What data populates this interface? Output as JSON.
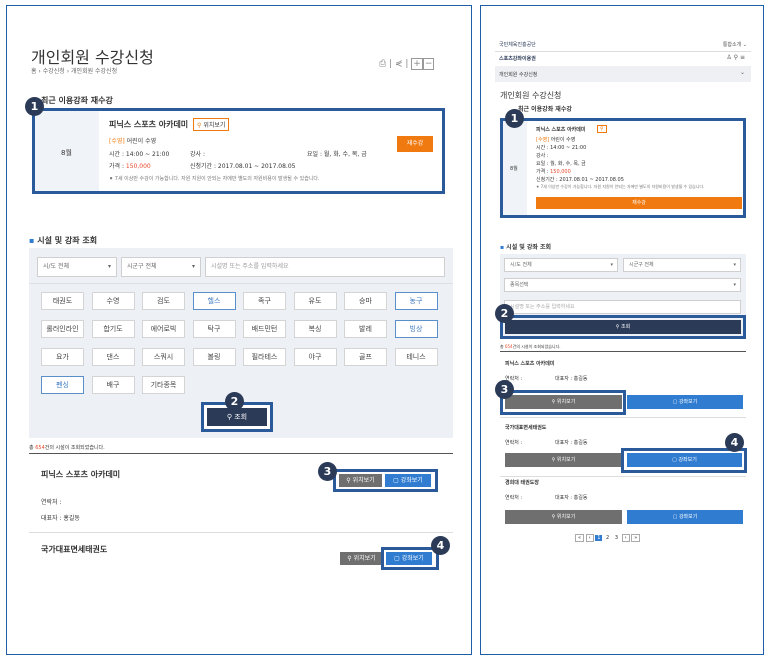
{
  "desktop": {
    "title": "개인회원 수강신청",
    "breadcrumb": "홈 › 수강신청 › 개인회원 수강신청",
    "recent_heading": "최근 이용강좌 재수강",
    "card": {
      "month": "8월",
      "facility": "피닉스 스포츠 아카데미",
      "location_btn": "위치보기",
      "course": "[수영] 어린이 수영",
      "time_label": "시간 : 14:00 ~ 21:00",
      "teacher_label": "강사 :",
      "day_label": "요일 : 월, 화, 수, 목, 금",
      "price_label": "가격 :",
      "price": "150,000",
      "period": "신청기간 : 2017.08.01 ~ 2017.08.05",
      "notice": "7세 이상만 수강이 가능합니다. 자원 지원이 안되는 자에만 별도의 자원비용이 발생될 수 있습니다.",
      "retake_btn": "재수강"
    },
    "search_heading": "시설 및 강좌 조회",
    "select_city": "시/도 전체",
    "select_district": "시군구 전체",
    "search_placeholder": "시설명 또는 주소를 입력하세요",
    "categories": [
      "태권도",
      "수영",
      "검도",
      "헬스",
      "족구",
      "유도",
      "승마",
      "농구",
      "롤러인라인",
      "합기도",
      "에어로빅",
      "탁구",
      "배드민턴",
      "복싱",
      "발레",
      "빙상",
      "요가",
      "댄스",
      "스쿼시",
      "볼링",
      "필라테스",
      "야구",
      "골프",
      "테니스",
      "펜싱",
      "배구",
      "기타종목"
    ],
    "search_btn": "조회",
    "result_prefix": "총 ",
    "result_count": "654",
    "result_suffix": "건의 시설이 조회되었습니다.",
    "results": [
      {
        "name": "피닉스 스포츠 아카데미",
        "contact": "연락처 :",
        "rep": "대표자 : 홍길동"
      },
      {
        "name": "국가대표면세태권도"
      }
    ],
    "loc_btn": "위치보기",
    "course_btn": "강좌보기"
  },
  "mobile": {
    "org": "국민체육진흥공단",
    "topright": "통합소개  ⌄",
    "service": "스포츠강좌이용권",
    "nav_title": "개인회원 수강신청",
    "title": "개인회원 수강신청",
    "recent_heading": "최근 이용강좌 재수강",
    "card": {
      "month": "8월",
      "facility": "피닉스 스포츠 아카데미",
      "course": "[수영] 어린이 수영",
      "time": "시간 : 14:00 ~ 21:00",
      "teacher": "강사 :",
      "day": "요일 : 월, 화, 수, 목, 금",
      "price_label": "가격 :",
      "price": "150,000",
      "period": "신청기간 : 2017.08.01 ~ 2017.08.05",
      "notice": "7세 이상만 수강이 가능합니다. 자원 지원이 안되는 자에만 별도의 자원비용이 발생될 수 있습니다.",
      "retake_btn": "재수강"
    },
    "search_heading": "시설 및 강좌 조회",
    "select_city": "시/도 전체",
    "select_district": "시군구 전체",
    "select_sport": "종목선택",
    "search_placeholder": "시설명 또는 주소를 입력하세요",
    "search_btn": "조회",
    "result_prefix": "총 ",
    "result_count": "654",
    "result_suffix": "건의 시설이 조회되었습니다.",
    "results": [
      {
        "name": "피닉스 스포츠 아카데미",
        "contact": "연락처 :",
        "rep": "대표자 : 홍길동"
      },
      {
        "name": "국가대표면세태권도",
        "contact": "연락처 :",
        "rep": "대표자 : 홍길동"
      },
      {
        "name": "경희대 태권도장",
        "contact": "연락처 :",
        "rep": "대표자 : 홍길동"
      }
    ],
    "loc_btn": "위치보기",
    "course_btn": "강좌보기",
    "pages": [
      "1",
      "2",
      "3"
    ]
  },
  "badges": [
    "1",
    "2",
    "3",
    "4"
  ]
}
